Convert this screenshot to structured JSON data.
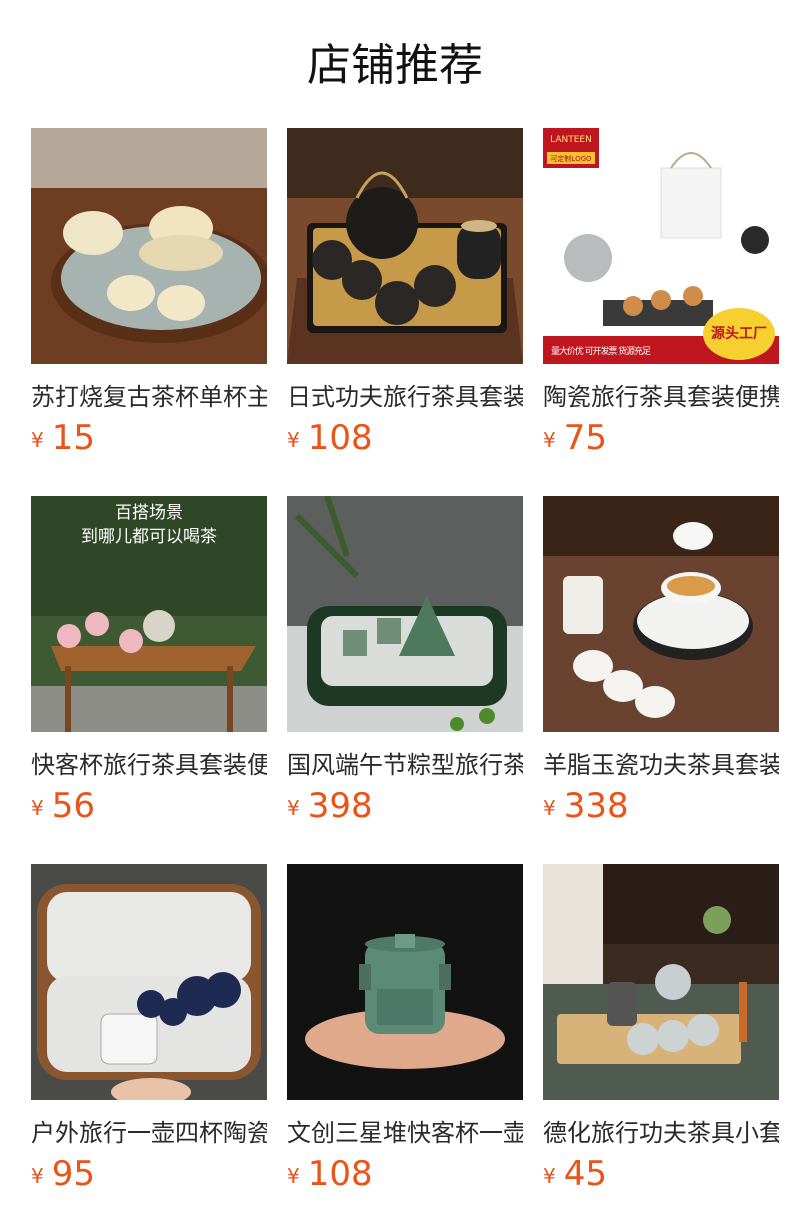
{
  "header": {
    "title": "店铺推荐"
  },
  "products": [
    {
      "name": "苏打烧复古茶杯单杯主人杯",
      "currency": "¥",
      "price": "15"
    },
    {
      "name": "日式功夫旅行茶具套装",
      "currency": "¥",
      "price": "108"
    },
    {
      "name": "陶瓷旅行茶具套装便携式",
      "currency": "¥",
      "price": "75",
      "badge": {
        "brand": "LANTEEN",
        "brand_sub": "可定制LOGO",
        "banner": "量大价优 可开发票 货源充足",
        "corner": "源头工厂"
      }
    },
    {
      "name": "快客杯旅行茶具套装便携",
      "currency": "¥",
      "price": "56",
      "overlay": {
        "headline1": "百搭场景",
        "headline2": "到哪儿都可以喝茶"
      }
    },
    {
      "name": "国风端午节粽型旅行茶具",
      "currency": "¥",
      "price": "398"
    },
    {
      "name": "羊脂玉瓷功夫茶具套装",
      "currency": "¥",
      "price": "338"
    },
    {
      "name": "户外旅行一壶四杯陶瓷茶具",
      "currency": "¥",
      "price": "95"
    },
    {
      "name": "文创三星堆快客杯一壶二杯",
      "currency": "¥",
      "price": "108"
    },
    {
      "name": "德化旅行功夫茶具小套装",
      "currency": "¥",
      "price": "45"
    }
  ]
}
